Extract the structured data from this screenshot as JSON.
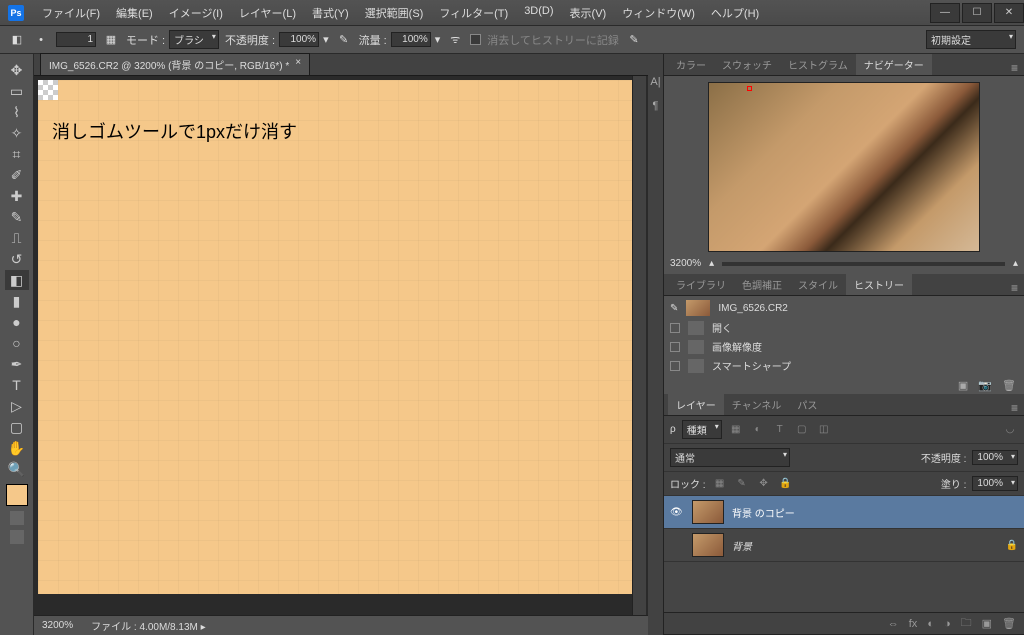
{
  "app": {
    "logo": "Ps"
  },
  "menu": [
    "ファイル(F)",
    "編集(E)",
    "イメージ(I)",
    "レイヤー(L)",
    "書式(Y)",
    "選択範囲(S)",
    "フィルター(T)",
    "3D(D)",
    "表示(V)",
    "ウィンドウ(W)",
    "ヘルプ(H)"
  ],
  "options": {
    "size_value": "1",
    "mode_label": "モード :",
    "mode_value": "ブラシ",
    "opacity_label": "不透明度 :",
    "opacity_value": "100%",
    "flow_label": "流量 :",
    "flow_value": "100%",
    "erase_history": "消去してヒストリーに記録",
    "preset": "初期設定"
  },
  "doc": {
    "tab": "IMG_6526.CR2 @ 3200% (背景 のコピー, RGB/16*) *",
    "canvas_text": "消しゴムツールで1pxだけ消す",
    "zoom": "3200%",
    "status_file_label": "ファイル :",
    "status_file": "4.00M/8.13M"
  },
  "nav_panel": {
    "tabs": [
      "カラー",
      "スウォッチ",
      "ヒストグラム",
      "ナビゲーター"
    ],
    "zoom": "3200%"
  },
  "hist_panel": {
    "tabs": [
      "ライブラリ",
      "色調補正",
      "スタイル",
      "ヒストリー"
    ],
    "title": "IMG_6526.CR2",
    "items": [
      "開く",
      "画像解像度",
      "スマートシャープ"
    ]
  },
  "layers_panel": {
    "tabs": [
      "レイヤー",
      "チャンネル",
      "パス"
    ],
    "kind_label": "種類",
    "blend": "通常",
    "opacity_label": "不透明度 :",
    "opacity_value": "100%",
    "lock_label": "ロック :",
    "fill_label": "塗り :",
    "fill_value": "100%",
    "layers": [
      {
        "name": "背景 のコピー",
        "selected": true
      },
      {
        "name": "背景",
        "selected": false,
        "locked": true
      }
    ]
  }
}
